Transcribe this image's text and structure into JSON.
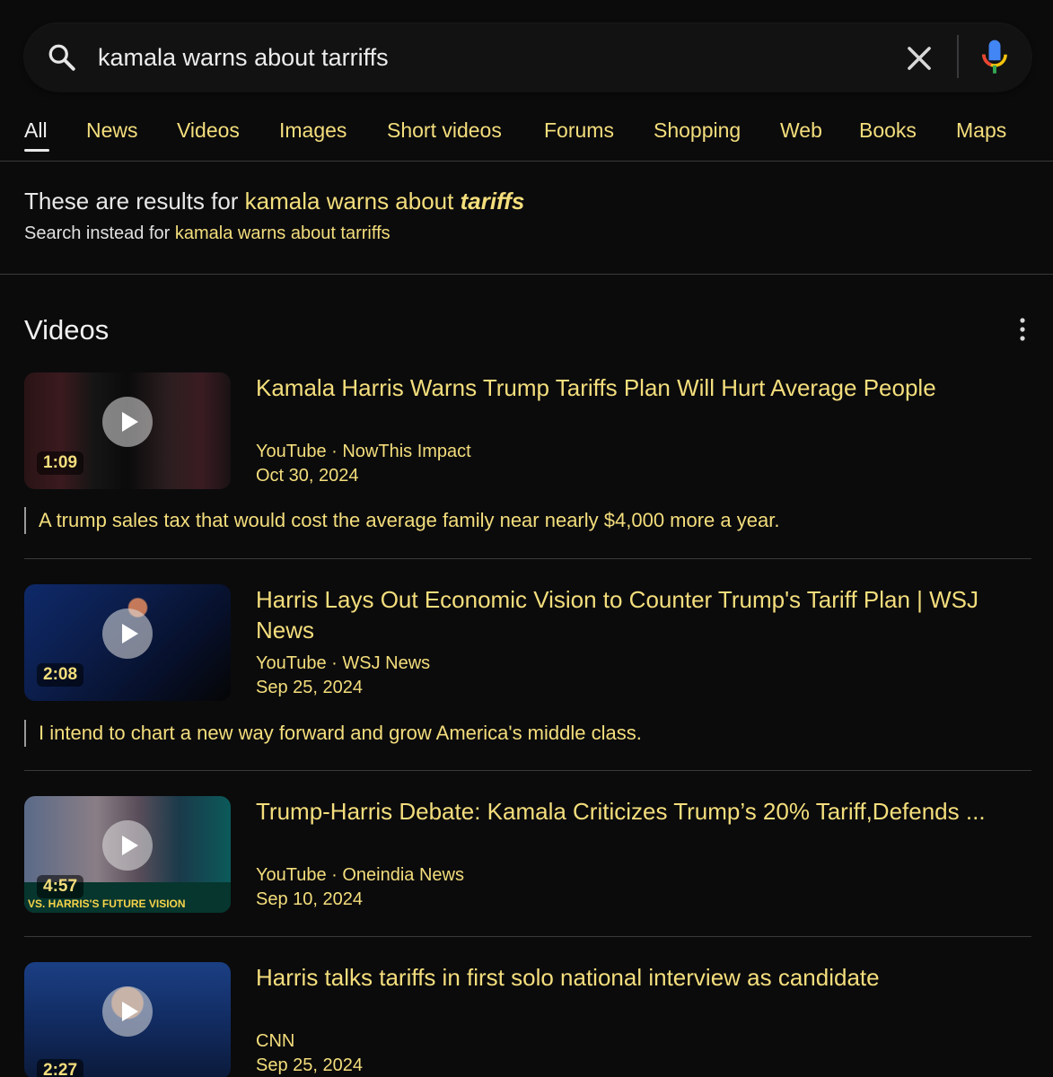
{
  "search": {
    "query": "kamala warns about tarriffs"
  },
  "tabs": [
    {
      "label": "All",
      "active": true
    },
    {
      "label": "News"
    },
    {
      "label": "Videos"
    },
    {
      "label": "Images"
    },
    {
      "label": "Short videos"
    },
    {
      "label": "Forums"
    },
    {
      "label": "Shopping"
    },
    {
      "label": "Web"
    },
    {
      "label": "Books"
    },
    {
      "label": "Maps"
    }
  ],
  "spelling": {
    "prefix": "These are results for",
    "corrected_start": "kamala warns about",
    "corrected_word": "tariffs",
    "instead_prefix": "Search instead for",
    "instead_query": "kamala warns about tarriffs"
  },
  "videos": {
    "heading": "Videos",
    "items": [
      {
        "title": "Kamala Harris Warns Trump Tariffs Plan Will Hurt Average People",
        "duration": "1:09",
        "source": "YouTube · NowThis Impact",
        "date": "Oct 30, 2024",
        "snippet": "A trump sales tax that would cost the average family near nearly $4,000 more a year."
      },
      {
        "title": "Harris Lays Out Economic Vision to Counter Trump's Tariff Plan | WSJ News",
        "duration": "2:08",
        "source": "YouTube · WSJ News",
        "date": "Sep 25, 2024",
        "snippet": "I intend to chart a new way forward and grow America's middle class."
      },
      {
        "title": "Trump-Harris Debate: Kamala Criticizes Trump’s 20% Tariff,Defends ...",
        "duration": "4:57",
        "source": "YouTube · Oneindia News",
        "date": "Sep 10, 2024",
        "thumb_text": "VS. HARRIS'S FUTURE VISION"
      },
      {
        "title": "Harris talks tariffs in first solo national interview as candidate",
        "duration": "2:27",
        "source": "CNN",
        "date": "Sep 25, 2024"
      }
    ]
  },
  "colors": {
    "background": "#0b0b0c",
    "accent": "#f4de7c",
    "text": "#e8e8e8"
  }
}
